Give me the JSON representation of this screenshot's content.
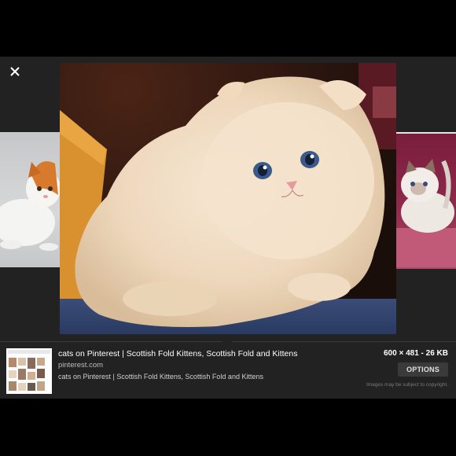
{
  "viewer": {
    "close_icon": "close-icon",
    "main_image_subject": "fluffy cream scottish fold kitten"
  },
  "info": {
    "title": "cats on Pinterest | Scottish Fold Kittens, Scottish Fold and Kittens",
    "site": "pinterest.com",
    "description": "cats on Pinterest | Scottish Fold Kittens, Scottish Fold and Kittens",
    "size": "600 × 481 - 26 KB",
    "options_label": "OPTIONS",
    "copyright": "Images may be subject to copyright."
  },
  "colors": {
    "background": "#000000",
    "panel": "#222222",
    "button": "#3a3a3a"
  }
}
